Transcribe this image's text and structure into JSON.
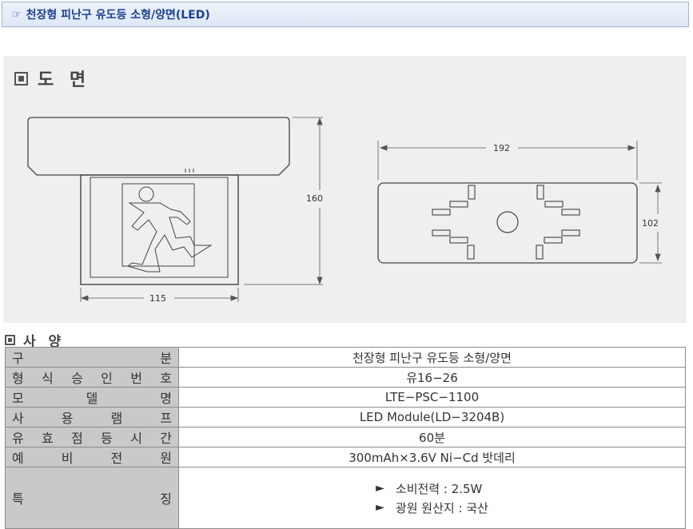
{
  "title_bar": {
    "icon": "pointing-hand-icon",
    "title": "천장형 피난구 유도등 소형/양면(LED)"
  },
  "drawing": {
    "heading": "도 면",
    "dimensions": {
      "height": "160",
      "base_width": "115",
      "face_width": "192",
      "face_height": "102"
    }
  },
  "spec": {
    "heading": "사 양",
    "rows": [
      {
        "label": [
          "구",
          "분"
        ],
        "value": "천장형 피난구 유도등 소형/양면"
      },
      {
        "label": [
          "형",
          "식",
          "승",
          "인",
          "번",
          "호"
        ],
        "value": "유16−26"
      },
      {
        "label": [
          "모",
          "델",
          "명"
        ],
        "value": "LTE−PSC−1100"
      },
      {
        "label": [
          "사",
          "용",
          "램",
          "프"
        ],
        "value": "LED Module(LD−3204B)"
      },
      {
        "label": [
          "유",
          "효",
          "점",
          "등",
          "시",
          "간"
        ],
        "value": "60분"
      },
      {
        "label": [
          "예",
          "비",
          "전",
          "원"
        ],
        "value": "300mAh×3.6V Ni−Cd 밧데리"
      }
    ],
    "features_label": [
      "특",
      "징"
    ],
    "features": [
      {
        "arrow": "►",
        "text": "소비전력 : 2.5W"
      },
      {
        "arrow": "►",
        "text": "광원 원산지 : 국산"
      }
    ]
  }
}
